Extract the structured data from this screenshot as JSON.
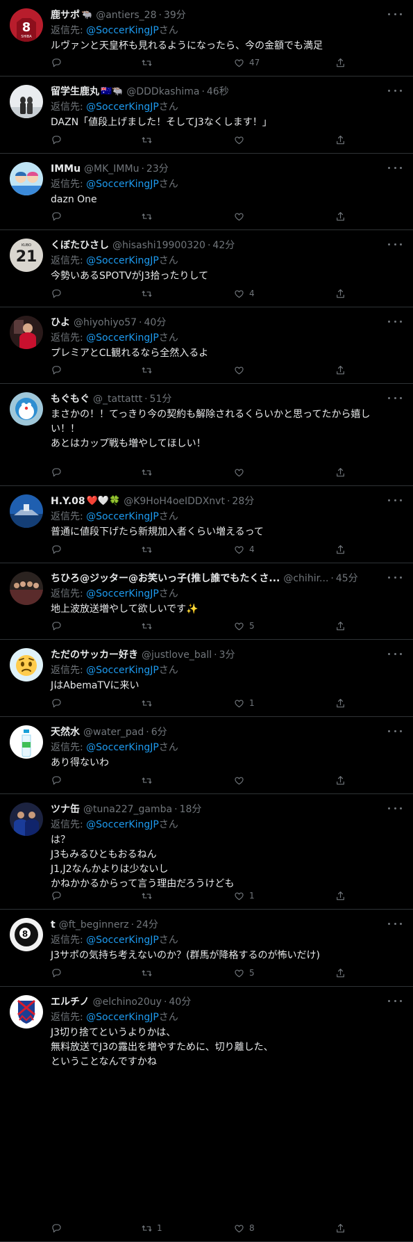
{
  "reply_prefix": "返信先: ",
  "mention_suffix": "さん",
  "colors": {
    "background": "#000000",
    "text": "#e7e9ea",
    "secondary": "#71767b",
    "link": "#1d9bf0",
    "divider": "#2f3336"
  },
  "tweets": [
    {
      "display_name": "鹿サポ",
      "emoji": "🐃",
      "handle": "@antiers_28",
      "time": "39分",
      "mention": "@SoccerKingJP",
      "text": "ルヴァンと天皇杯も見れるようになったら、今の金額でも満足",
      "reply_count": "",
      "retweet_count": "",
      "like_count": "47",
      "avatar_icon": "red-jersey-avatar-icon"
    },
    {
      "display_name": "留学生鹿丸",
      "emoji": "🇦🇺🐃",
      "handle": "@DDDkashima",
      "time": "46秒",
      "mention": "@SoccerKingJP",
      "text": "DAZN「値段上げました！そしてJ3なくします！」",
      "reply_count": "",
      "retweet_count": "",
      "like_count": "",
      "avatar_icon": "couple-photo-avatar-icon"
    },
    {
      "display_name": "IMMu",
      "emoji": "",
      "handle": "@MK_IMMu",
      "time": "23分",
      "mention": "@SoccerKingJP",
      "text": "dazn One",
      "reply_count": "",
      "retweet_count": "",
      "like_count": "",
      "avatar_icon": "anime-avatar-icon"
    },
    {
      "display_name": "くぼたひさし",
      "emoji": "",
      "handle": "@hisashi19900320",
      "time": "42分",
      "mention": "@SoccerKingJP",
      "text": "今勢いあるSPOTVがJ3拾ったりして",
      "reply_count": "",
      "retweet_count": "",
      "like_count": "4",
      "avatar_icon": "number-21-avatar-icon"
    },
    {
      "display_name": "ひよ",
      "emoji": "",
      "handle": "@hiyohiyo57",
      "time": "40分",
      "mention": "@SoccerKingJP",
      "text": "プレミアとCL観れるなら全然入るよ",
      "reply_count": "",
      "retweet_count": "",
      "like_count": "",
      "avatar_icon": "player-photo-avatar-icon"
    },
    {
      "display_name": "もぐもぐ",
      "emoji": "",
      "handle": "@_tattattt",
      "time": "51分",
      "mention": "",
      "text": "まさかの！！てっきり今の契約も解除されるくらいかと思ってたから嬉しい！！\nあとはカップ戦も増やしてほしい！",
      "reply_count": "",
      "retweet_count": "",
      "like_count": "",
      "avatar_icon": "cartoon-cat-avatar-icon"
    },
    {
      "display_name": "H.Y.08",
      "emoji": "❤️🤍🍀",
      "handle": "@K9HoH4oeIDDXnvt",
      "time": "28分",
      "mention": "@SoccerKingJP",
      "text": "普通に値段下げたら新規加入者くらい増えるって",
      "reply_count": "",
      "retweet_count": "",
      "like_count": "4",
      "avatar_icon": "stadium-avatar-icon"
    },
    {
      "display_name": "ちひろ@ジッター@お笑いっ子(推し誰でもたくさ...",
      "emoji": "",
      "handle": "@chihir...",
      "time": "45分",
      "mention": "@SoccerKingJP",
      "text": "地上波放送増やして欲しいです✨",
      "reply_count": "",
      "retweet_count": "",
      "like_count": "5",
      "avatar_icon": "group-photo-avatar-icon"
    },
    {
      "display_name": "ただのサッカー好き",
      "emoji": "",
      "handle": "@justlove_ball",
      "time": "3分",
      "mention": "@SoccerKingJP",
      "text": "JはAbemaTVに来い",
      "reply_count": "",
      "retweet_count": "",
      "like_count": "1",
      "avatar_icon": "worried-face-avatar-icon"
    },
    {
      "display_name": "天然水",
      "emoji": "",
      "handle": "@water_pad",
      "time": "6分",
      "mention": "@SoccerKingJP",
      "text": "あり得ないわ",
      "reply_count": "",
      "retweet_count": "",
      "like_count": "",
      "avatar_icon": "water-bottle-avatar-icon"
    },
    {
      "display_name": "ツナ缶",
      "emoji": "",
      "handle": "@tuna227_gamba",
      "time": "18分",
      "mention": "@SoccerKingJP",
      "text": "は？\nJ3もみるひともおるねん\nJ1,J2なんかよりは少ないし\nかねかかるからって言う理由だろうけども",
      "reply_count": "",
      "retweet_count": "",
      "like_count": "1",
      "avatar_icon": "team-photo-avatar-icon"
    },
    {
      "display_name": "t",
      "emoji": "",
      "handle": "@ft_beginnerz",
      "time": "24分",
      "mention": "@SoccerKingJP",
      "text": "J3サポの気持ち考えないのか？(群馬が降格するのが怖いだけ)",
      "reply_count": "",
      "retweet_count": "",
      "like_count": "5",
      "avatar_icon": "eight-ball-avatar-icon"
    },
    {
      "display_name": "エルチノ",
      "emoji": "",
      "handle": "@elchino20uy",
      "time": "40分",
      "mention": "@SoccerKingJP",
      "text": "J3切り捨てというよりかは、\n無料放送でJ3の露出を増やすために、切り離した、\nということなんですかね",
      "reply_count": "",
      "retweet_count": "1",
      "like_count": "8",
      "avatar_icon": "crest-avatar-icon"
    }
  ]
}
